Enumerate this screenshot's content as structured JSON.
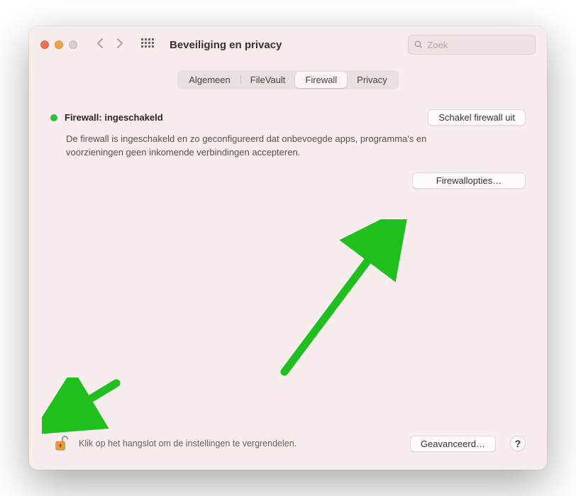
{
  "header": {
    "title": "Beveiliging en privacy",
    "search_placeholder": "Zoek"
  },
  "tabs": [
    {
      "label": "Algemeen"
    },
    {
      "label": "FileVault"
    },
    {
      "label": "Firewall"
    },
    {
      "label": "Privacy"
    }
  ],
  "firewall": {
    "status_label": "Firewall: ingeschakeld",
    "disable_button": "Schakel firewall uit",
    "description": "De firewall is ingeschakeld en zo geconfigureerd dat onbevoegde apps, programma's en voorzieningen geen inkomende verbindingen accepteren.",
    "options_button": "Firewallopties…",
    "status_color": "#27c23a"
  },
  "footer": {
    "lock_label": "Klik op het hangslot om de instellingen te vergrendelen.",
    "advanced_button": "Geavanceerd…",
    "help_label": "?"
  },
  "colors": {
    "accent_green_arrow": "#1fbf1f"
  }
}
